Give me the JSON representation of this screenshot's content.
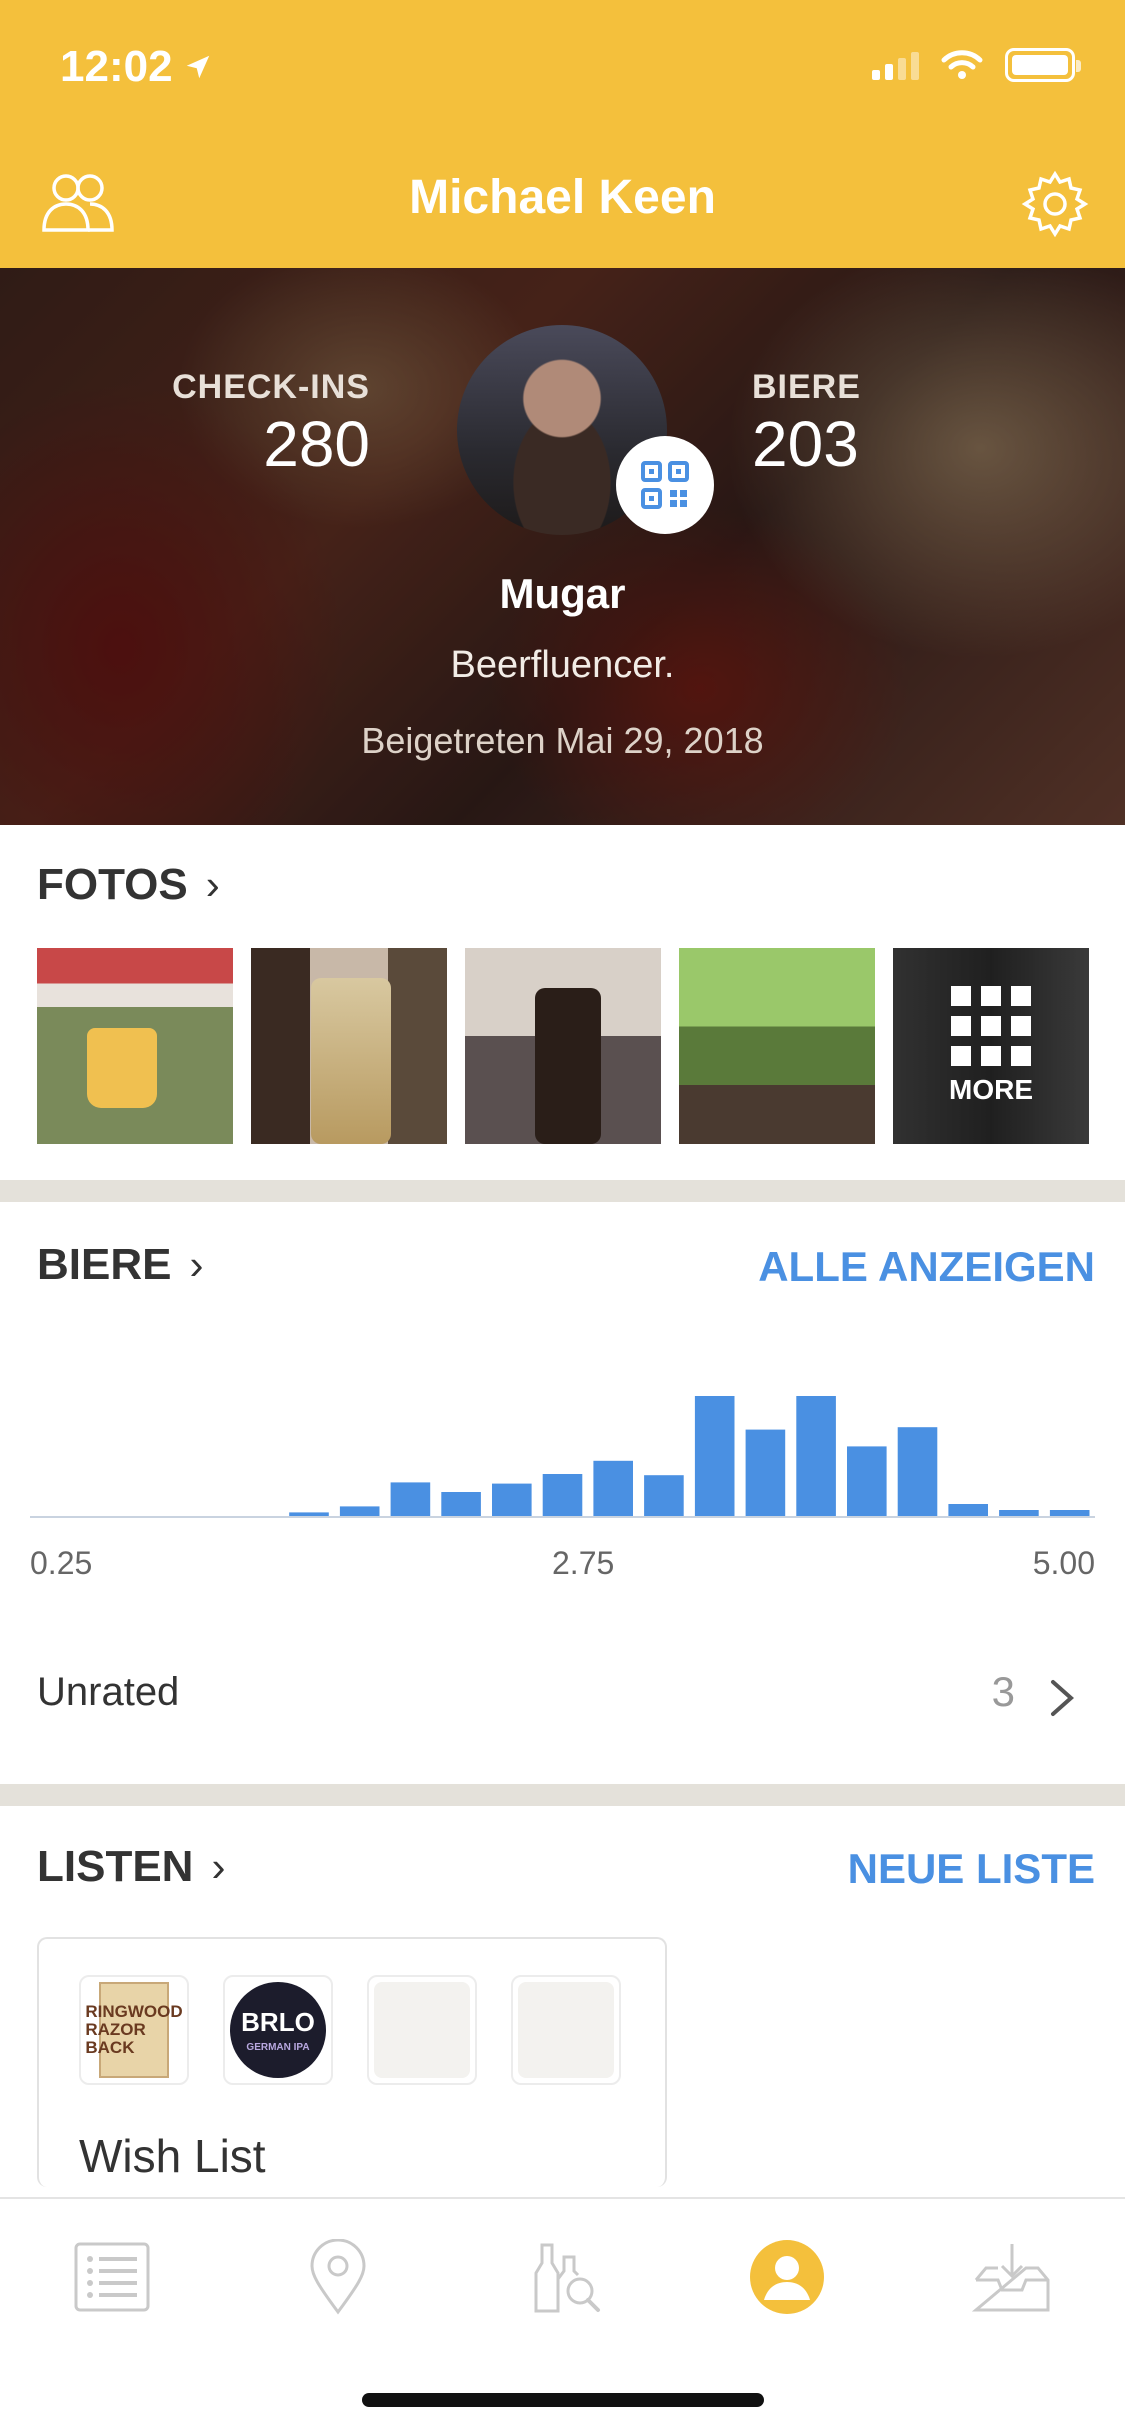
{
  "status_bar": {
    "time": "12:02"
  },
  "nav": {
    "title": "Michael Keen"
  },
  "profile": {
    "checkins_label": "CHECK-INS",
    "checkins_value": "280",
    "beers_label": "BIERE",
    "beers_value": "203",
    "username": "Mugar",
    "bio": "Beerfluencer.",
    "joined": "Beigetreten Mai 29, 2018"
  },
  "photos": {
    "title": "FOTOS",
    "more_label": "MORE"
  },
  "beers": {
    "title": "BIERE",
    "action": "ALLE ANZEIGEN",
    "unrated_label": "Unrated",
    "unrated_count": "3"
  },
  "chart_data": {
    "type": "bar",
    "categories": [
      "0.25",
      "0.50",
      "0.75",
      "1.00",
      "1.25",
      "1.50",
      "1.75",
      "2.00",
      "2.25",
      "2.50",
      "2.75",
      "3.00",
      "3.25",
      "3.50",
      "3.75",
      "4.00",
      "4.25",
      "4.50",
      "4.75",
      "5.00"
    ],
    "values": [
      0,
      0,
      0,
      0,
      0,
      3,
      8,
      28,
      20,
      27,
      35,
      46,
      34,
      100,
      72,
      100,
      58,
      74,
      10,
      5,
      5
    ],
    "tick_labels": [
      "0.25",
      "2.75",
      "5.00"
    ],
    "color": "#4a90e2"
  },
  "lists": {
    "title": "LISTEN",
    "action": "NEUE LISTE",
    "items": [
      {
        "name": "Wish List",
        "razor_text": "RINGWOOD RAZOR BACK",
        "brlo_text": "BRLO",
        "brlo_sub": "GERMAN IPA"
      }
    ]
  },
  "tabs": [
    "activity-feed",
    "venues",
    "beer-search",
    "profile",
    "notifications"
  ],
  "colors": {
    "header": "#f4c03c",
    "link": "#4a90e2",
    "tab_inactive": "#c9c9c9",
    "tab_active": "#f4c03c"
  }
}
